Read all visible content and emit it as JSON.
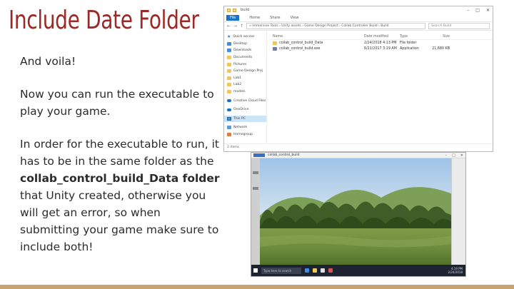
{
  "slide": {
    "title": "Include Date Folder",
    "para1": "And voila!",
    "para2": "Now you can run the executable to play your game.",
    "para3_before": "In order for the executable to run, it has to be in the same folder as the ",
    "para3_bold": "collab_control_build_Data folder",
    "para3_after": " that Unity created, otherwise you will get an error, so when submitting your game make sure to include both!"
  },
  "explorer": {
    "title": "build",
    "menu": [
      "File",
      "Home",
      "Share",
      "View"
    ],
    "path": "« Immersive Tools › Unity assets › Game Design Project › Collab Controller Build › Build",
    "search_placeholder": "Search Build",
    "nav_items": [
      {
        "label": "Quick access",
        "icon": "star"
      },
      {
        "label": "Desktop",
        "icon": "blue"
      },
      {
        "label": "Downloads",
        "icon": "blue"
      },
      {
        "label": "Documents",
        "icon": "folder"
      },
      {
        "label": "Pictures",
        "icon": "folder"
      },
      {
        "label": "Game Design Proj",
        "icon": "folder"
      },
      {
        "label": "Lab1",
        "icon": "folder"
      },
      {
        "label": "Lab2",
        "icon": "folder"
      },
      {
        "label": "models",
        "icon": "folder"
      },
      {
        "label": "Creative Cloud Files",
        "icon": "cloud"
      },
      {
        "label": "OneDrive",
        "icon": "cloud"
      },
      {
        "label": "This PC",
        "icon": "pc"
      },
      {
        "label": "Network",
        "icon": "net"
      },
      {
        "label": "Homegroup",
        "icon": "home"
      }
    ],
    "columns": {
      "name": "Name",
      "date": "Date modified",
      "type": "Type",
      "size": "Size"
    },
    "files": [
      {
        "name": "collab_control_build_Data",
        "date": "2/24/2018 4:13 PM",
        "type": "File folder",
        "size": "",
        "icon": "folder"
      },
      {
        "name": "collab_control_build.exe",
        "date": "6/21/2017 3:19 AM",
        "type": "Application",
        "size": "21,680 KB",
        "icon": "app"
      }
    ],
    "status": "2 items"
  },
  "game": {
    "title": "collab_control_build",
    "taskbar_search": "Type here to search",
    "clock_time": "4:19 PM",
    "clock_date": "2/24/2018"
  }
}
